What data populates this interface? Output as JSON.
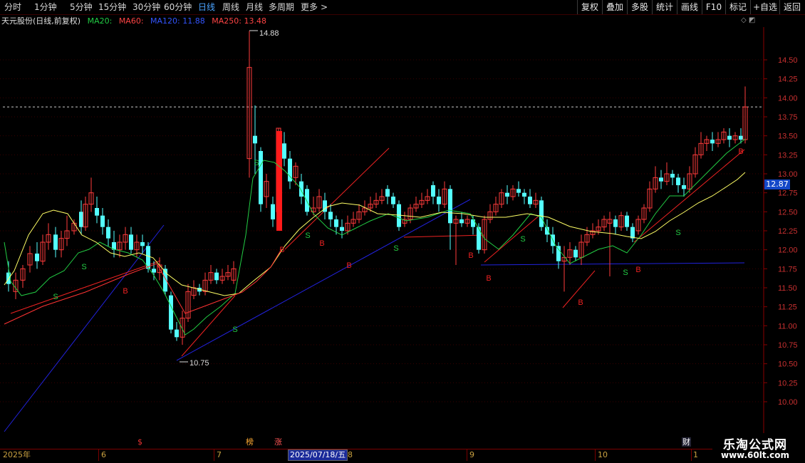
{
  "toolbar": {
    "left_items": [
      {
        "label": "分时",
        "active": false
      },
      {
        "label": "1分钟",
        "active": false
      },
      {
        "label": "5分钟",
        "active": false
      },
      {
        "label": "15分钟",
        "active": false
      },
      {
        "label": "30分钟",
        "active": false
      },
      {
        "label": "60分钟",
        "active": false
      },
      {
        "label": "日线",
        "active": true
      },
      {
        "label": "周线",
        "active": false
      },
      {
        "label": "月线",
        "active": false
      },
      {
        "label": "多周期",
        "active": false
      },
      {
        "label": "更多",
        "active": false
      }
    ],
    "more_arrow": ">",
    "right_items": [
      "复权",
      "叠加",
      "多股",
      "统计",
      "画线",
      "F10",
      "标记",
      "+自选",
      "返回"
    ]
  },
  "legend": {
    "title": "天元股份(日线,前复权)",
    "ma20": "MA20:",
    "ma60": "MA60:",
    "ma120": "MA120: 11.88",
    "ma250": "MA250: 13.48"
  },
  "price_tag": "12.87",
  "corner_icons": "◇ ◩",
  "chart_data": {
    "type": "candlestick",
    "y_range": [
      10.0,
      14.75
    ],
    "y_ticks": [
      "14.50",
      "14.25",
      "14.00",
      "13.75",
      "13.50",
      "13.25",
      "13.00",
      "12.75",
      "12.50",
      "12.25",
      "12.00",
      "11.75",
      "11.50",
      "11.25",
      "11.00",
      "10.75",
      "10.50",
      "10.25",
      "10.00"
    ],
    "high_marker": "14.88",
    "low_marker": "10.75",
    "dashed_level": 13.88,
    "date_labels": [
      "2025年",
      "6",
      "7",
      "8",
      "9",
      "10",
      "1"
    ],
    "cursor_date": "2025/07/18/五",
    "signals": [
      {
        "text": "S",
        "color": "#22cc44"
      },
      {
        "text": "S",
        "color": "#22cc44"
      },
      {
        "text": "S",
        "color": "#22cc44"
      },
      {
        "text": "S",
        "color": "#22cc44"
      },
      {
        "text": "S",
        "color": "#22cc44"
      },
      {
        "text": "S",
        "color": "#22cc44"
      },
      {
        "text": "S",
        "color": "#22cc44"
      },
      {
        "text": "S",
        "color": "#22cc44"
      },
      {
        "text": "S",
        "color": "#22cc44"
      },
      {
        "text": "B",
        "color": "#ee2222"
      },
      {
        "text": "B",
        "color": "#ee2222"
      },
      {
        "text": "B",
        "color": "#ee2222"
      },
      {
        "text": "B",
        "color": "#ee2222"
      },
      {
        "text": "B",
        "color": "#ee2222"
      },
      {
        "text": "B",
        "color": "#ee2222"
      },
      {
        "text": "B",
        "color": "#ee2222"
      },
      {
        "text": "B",
        "color": "#ee2222"
      },
      {
        "text": "B",
        "color": "#ee2222"
      }
    ],
    "events": [
      {
        "text": "$",
        "color": "#ee3333"
      },
      {
        "text": "榜",
        "color": "#ffaa33"
      },
      {
        "text": "涨",
        "color": "#ff5555"
      },
      {
        "text": "财",
        "color": "#ffffff"
      }
    ]
  },
  "watermark": {
    "title": "乐淘公式网",
    "url": "www.60lt.com"
  },
  "colors": {
    "up": "#ff3b3b",
    "down": "#54ffff",
    "ma20": "#22cc44",
    "ma60": "#ffff66",
    "ma250": "#ff3333",
    "ma120": "#2233ff"
  }
}
